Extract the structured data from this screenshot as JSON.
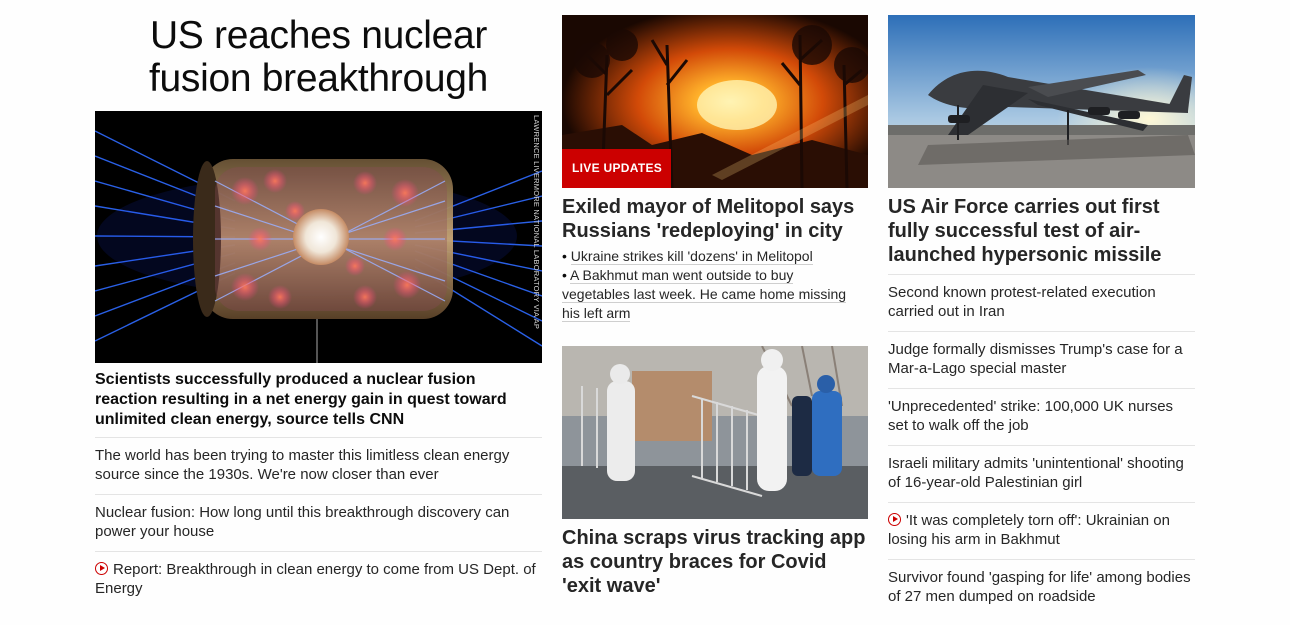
{
  "col1": {
    "headline": "US reaches nuclear fusion breakthrough",
    "image_credit": "LAWRENCE LIVERMORE NATIONAL LABORATORY VIA AP",
    "subhead": "Scientists successfully produced a nuclear fusion reaction resulting in a net energy gain in quest toward unlimited clean energy, source tells CNN",
    "links": [
      {
        "text": "The world has been trying to master this limitless clean energy source since the 1930s. We're now closer than ever",
        "video": false
      },
      {
        "text": "Nuclear fusion: How long until this breakthrough discovery can power your house",
        "video": false
      },
      {
        "text": "Report: Breakthrough in clean energy to come from US Dept. of Energy",
        "video": true,
        "icon": "play-icon"
      }
    ]
  },
  "col2": {
    "badge": "LIVE UPDATES",
    "story1": {
      "title": "Exiled mayor of Melitopol says Russians 'redeploying' in city",
      "bullets": [
        "Ukraine strikes kill 'dozens' in Melitopol",
        "A Bakhmut man went outside to buy vegetables last week. He came home missing his left arm"
      ]
    },
    "story2": {
      "title": "China scraps virus tracking app as country braces for Covid 'exit wave'"
    }
  },
  "col3": {
    "title": "US Air Force carries out first fully successful test of air-launched hypersonic missile",
    "links": [
      {
        "text": "Second known protest-related execution carried out in Iran",
        "video": false
      },
      {
        "text": "Judge formally dismisses Trump's case for a Mar-a-Lago special master",
        "video": false
      },
      {
        "text": "'Unprecedented' strike: 100,000 UK nurses set to walk off the job",
        "video": false
      },
      {
        "text": "Israeli military admits 'unintentional' shooting of 16-year-old Palestinian girl",
        "video": false
      },
      {
        "text": "'It was completely torn off': Ukrainian on losing his arm in Bakhmut",
        "video": true,
        "icon": "play-icon"
      },
      {
        "text": "Survivor found 'gasping for life' among bodies of 27 men dumped on roadside",
        "video": false
      }
    ]
  },
  "colors": {
    "live_badge": "#cc0000",
    "divider": "#e4e4e4",
    "text": "#262626"
  }
}
